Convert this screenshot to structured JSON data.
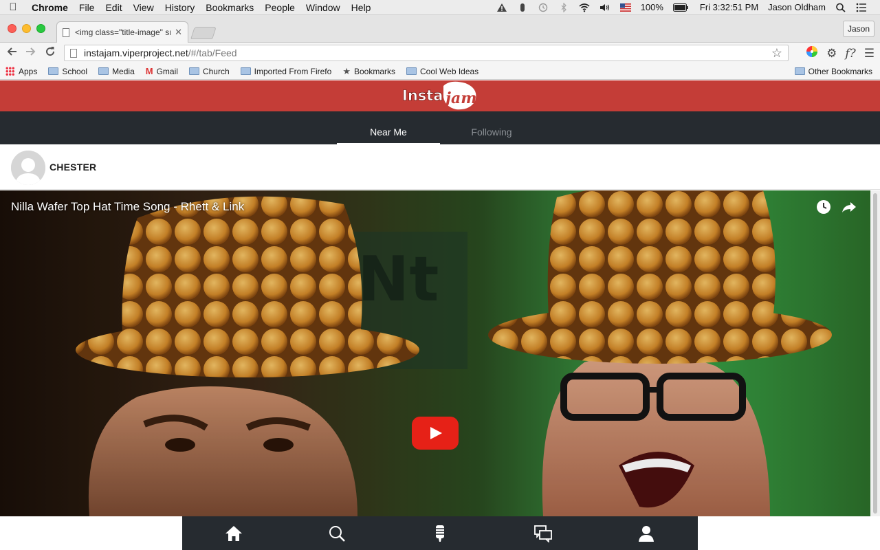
{
  "menubar": {
    "app": "Chrome",
    "items": [
      "File",
      "Edit",
      "View",
      "History",
      "Bookmarks",
      "People",
      "Window",
      "Help"
    ],
    "battery": "100%",
    "clock": "Fri 3:32:51 PM",
    "user": "Jason Oldham"
  },
  "browser": {
    "tab_title": "<img class=\"title-image\" sr",
    "profile": "Jason",
    "url_host": "instajam.viperproject.net",
    "url_path": "/#/tab/Feed"
  },
  "bookmarks": {
    "items": [
      "Apps",
      "School",
      "Media",
      "Gmail",
      "Church",
      "Imported From Firefo",
      "Bookmarks",
      "Cool Web Ideas"
    ],
    "other": "Other Bookmarks"
  },
  "app": {
    "logo_text_1": "Insta",
    "logo_text_2": "jam",
    "tabs": [
      "Near Me",
      "Following"
    ],
    "post_user": "CHESTER",
    "video_title": "Nilla Wafer Top Hat Time Song - Rhett & Link"
  },
  "colors": {
    "header": "#c43d37",
    "nav": "#262b30",
    "play": "#e62117"
  }
}
